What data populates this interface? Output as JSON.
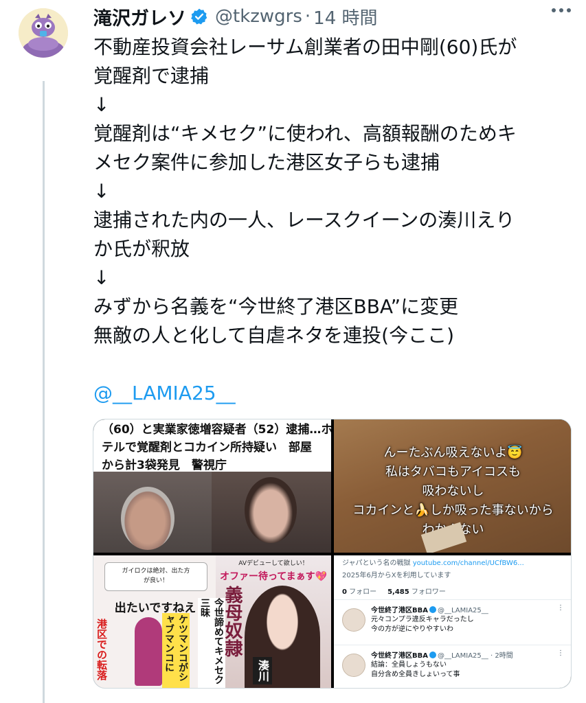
{
  "tweet": {
    "display_name": "滝沢ガレソ",
    "handle": "@tkzwgrs",
    "separator": "·",
    "time": "14 時間",
    "lines": [
      "不動産投資会社レーサム創業者の田中剛(60)氏が",
      "覚醒剤で逮捕",
      "↓",
      "覚醒剤は“キメセク”に使われ、高額報酬のためキ",
      "メセク案件に参加した港区女子らも逮捕",
      "↓",
      "逮捕された内の一人、レースクイーンの湊川えり",
      "か氏が釈放",
      "↓",
      "みずから名義を“今世終了港区BBA”に変更",
      "無敵の人と化して自虐ネタを連投(今ここ)",
      ""
    ],
    "mention": "@__LAMIA25__",
    "icons": {
      "verified": "verified-badge-icon",
      "more": "more-options-icon"
    },
    "colors": {
      "link": "#1d9bf0",
      "verified": "#1d9bf0"
    }
  },
  "media": {
    "news": {
      "lines": [
        "（60）と実業家徳増容疑者（52）逮捕…ホ",
        "テルで覚醒剤とコカイン所持疑い　部屋",
        "から計3袋発見　警視庁"
      ]
    },
    "caption_image": {
      "lines": [
        "んーたぶん吸えないよ😇",
        "私はタバコもアイコスも",
        "吸わないし",
        "コカインと🍌しか吸った事ないから",
        "わかんない"
      ]
    },
    "collage": {
      "bubble": "ガイロクは絶対、出た方\nが良い！",
      "want_out": "出たいですねえ",
      "vert_left": "港区での転落",
      "vert_mid": "ケツマンコがシャブマンコに",
      "vert_right": "今世諦めてキメセク三昧",
      "av_top": "AVデビューして欲しい！",
      "offer": "オファー待ってまぁす💖",
      "title": "義母奴隷",
      "name_frag": "湊川"
    },
    "profile": {
      "bio_frag": "ジャパという名の戦獄",
      "yt": "youtube.com/channel/UCfBW6...",
      "joined": "2025年6月からXを利用しています",
      "following_count": "0",
      "following_label": "フォロー",
      "followers_count": "5,485",
      "followers_label": "フォロワー",
      "posts": [
        {
          "name": "今世終了港区BBA",
          "handle": "@__LAMIA25__",
          "time": "",
          "line1": "元々コンプラ違反キャラだったし",
          "line2": "今の方が逆にやりやすいわ"
        },
        {
          "name": "今世終了港区BBA",
          "handle": "@__LAMIA25__",
          "time": "· 2時間",
          "line1": "結論：全員しょうもない",
          "line2": "自分含め全員きしょいって事"
        }
      ]
    }
  }
}
